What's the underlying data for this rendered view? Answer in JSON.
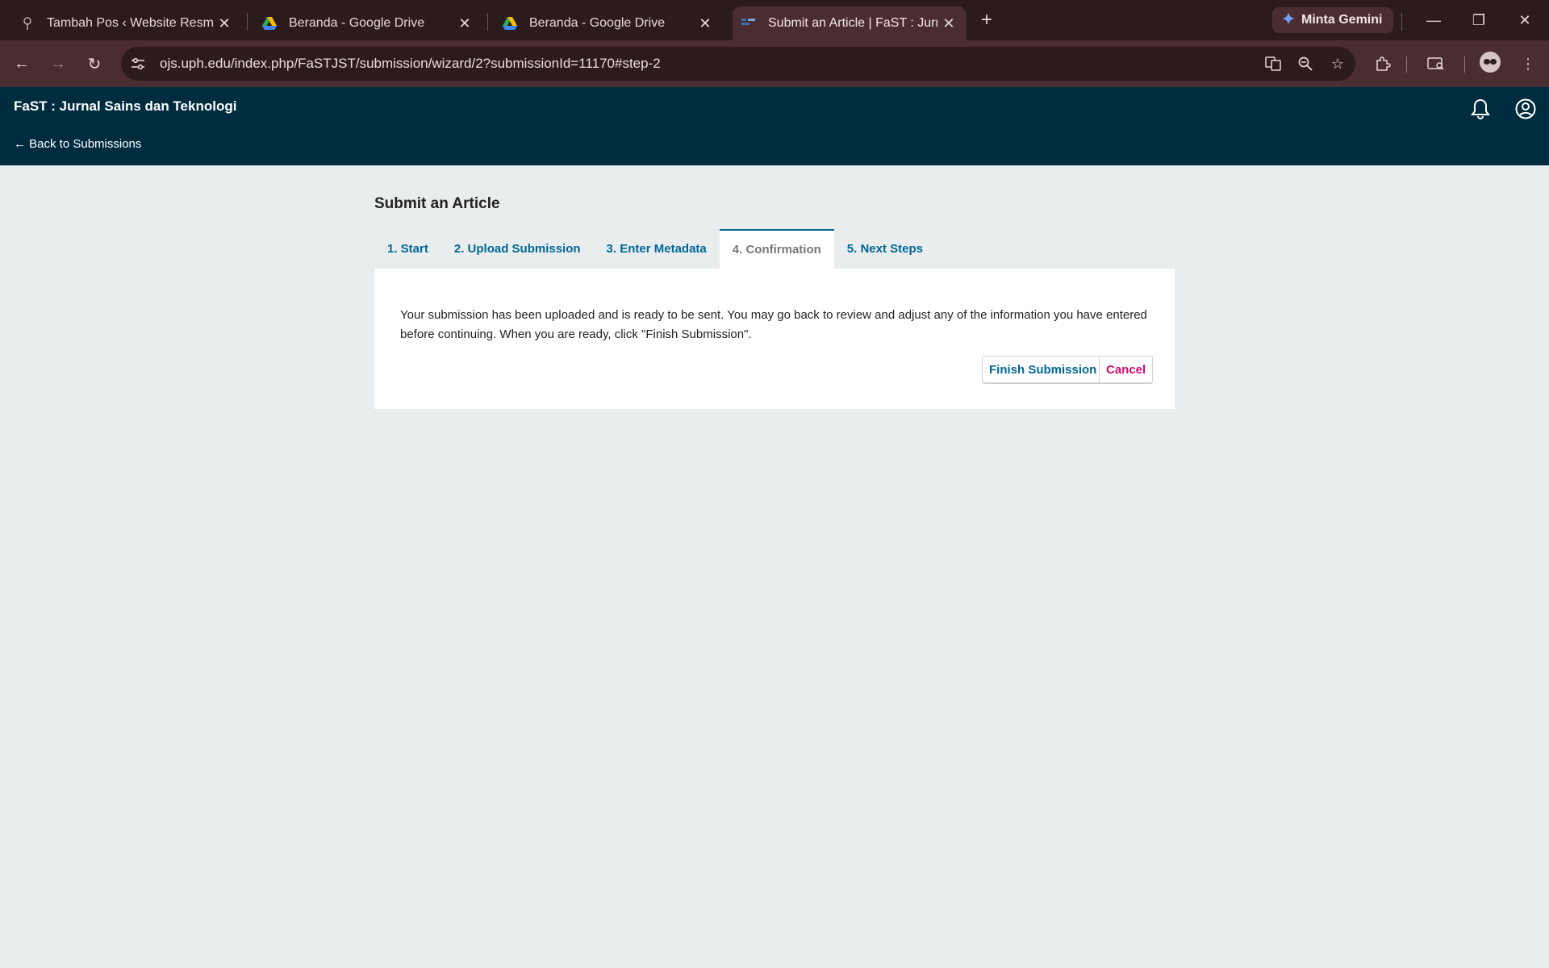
{
  "browser": {
    "tabs": [
      {
        "title": "Tambah Pos ‹ Website Resmi PT",
        "favicon": "pin-icon",
        "active": false
      },
      {
        "title": "Beranda - Google Drive",
        "favicon": "google-drive-icon",
        "active": false
      },
      {
        "title": "Beranda - Google Drive",
        "favicon": "google-drive-icon",
        "active": false
      },
      {
        "title": "Submit an Article | FaST : Jurnal",
        "favicon": "ojs-icon",
        "active": true
      }
    ],
    "gemini_label": "Minta Gemini",
    "url": "ojs.uph.edu/index.php/FaSTJST/submission/wizard/2?submissionId=11170#step-2"
  },
  "header": {
    "journal_title": "FaST : Jurnal Sains dan Teknologi",
    "back_label": "← Back to Submissions"
  },
  "main": {
    "page_title": "Submit an Article",
    "steps": [
      {
        "label": "1. Start",
        "active": false
      },
      {
        "label": "2. Upload Submission",
        "active": false
      },
      {
        "label": "3. Enter Metadata",
        "active": false
      },
      {
        "label": "4. Confirmation",
        "active": true
      },
      {
        "label": "5. Next Steps",
        "active": false
      }
    ],
    "confirmation_text": "Your submission has been uploaded and is ready to be sent. You may go back to review and adjust any of the information you have entered before continuing. When you are ready, click \"Finish Submission\".",
    "finish_label": "Finish Submission",
    "cancel_label": "Cancel"
  },
  "colors": {
    "header_bg": "#002c40",
    "link": "#006798",
    "cancel": "#d00a6c",
    "page_bg": "#e9eded"
  }
}
